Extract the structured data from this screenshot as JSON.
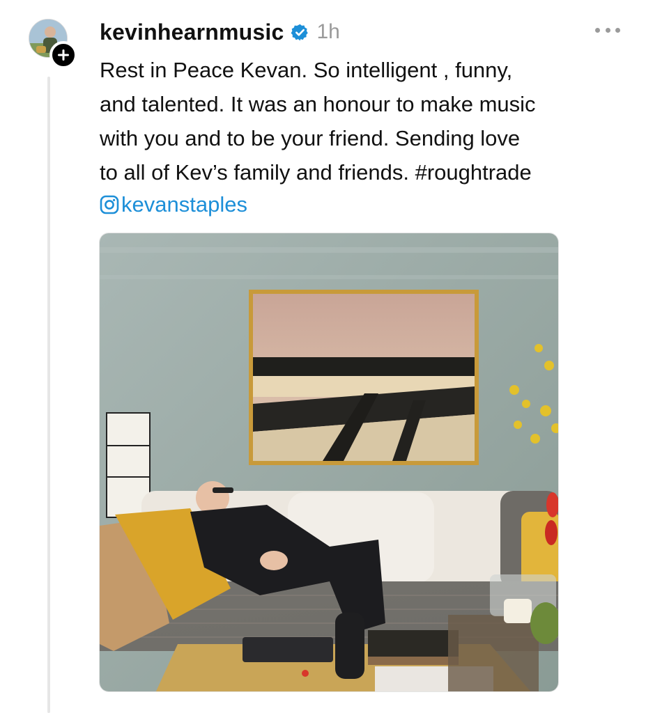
{
  "post": {
    "username": "kevinhearnmusic",
    "timestamp": "1h",
    "verified_icon": "verified-badge-icon",
    "more_icon": "more-dots-icon",
    "caption_lines": [
      "Rest in Peace Kevan.  So intelligent , funny,",
      "and talented.  It was an honour to make music",
      "with you and to be your friend.  Sending love",
      "to all of Kev’s family and friends.  #roughtrade"
    ],
    "mention": "kevanstaples",
    "mention_icon": "instagram-icon",
    "follow_icon": "plus-icon",
    "colors": {
      "accent": "#1d8fd8",
      "verified": "#1d8fd8",
      "muted": "#9a9a9a",
      "text": "#111111"
    }
  }
}
